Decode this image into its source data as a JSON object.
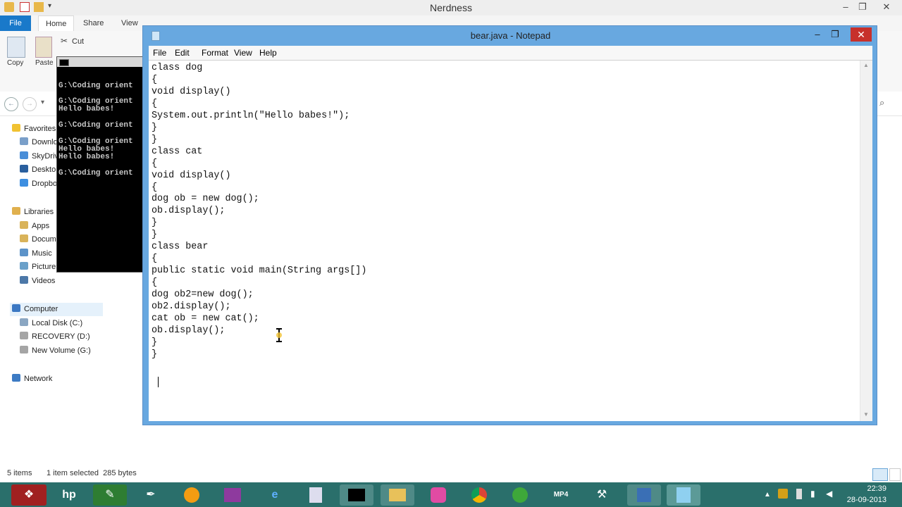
{
  "explorer": {
    "window_title": "Nerdness",
    "tabs": [
      "File",
      "Home",
      "Share",
      "View"
    ],
    "ribbon": {
      "copy": "Copy",
      "paste": "Paste",
      "cut": "Cut"
    },
    "nav": {
      "favorites": "Favorites",
      "fav_items": [
        "Downloads",
        "SkyDrive",
        "Desktop",
        "Dropbox"
      ],
      "libraries": "Libraries",
      "lib_items": [
        "Apps",
        "Documents",
        "Music",
        "Pictures",
        "Videos"
      ],
      "computer": "Computer",
      "drives": [
        "Local Disk (C:)",
        "RECOVERY (D:)",
        "New Volume (G:)"
      ],
      "network": "Network"
    },
    "status": {
      "items": "5 items",
      "selection": "1 item selected  285 bytes"
    }
  },
  "console": {
    "lines": [
      "G:\\Coding orient",
      "",
      "G:\\Coding orient",
      "Hello babes!",
      "",
      "G:\\Coding orient",
      "",
      "G:\\Coding orient",
      "Hello babes!",
      "Hello babes!",
      "",
      "G:\\Coding orient"
    ]
  },
  "notepad": {
    "title": "bear.java - Notepad",
    "menu": [
      "File",
      "Edit",
      "Format",
      "View",
      "Help"
    ],
    "code": "class dog\n{\nvoid display()\n{\nSystem.out.println(\"Hello babes!\");\n}\n}\nclass cat\n{\nvoid display()\n{\ndog ob = new dog();\nob.display();\n}\n}\nclass bear\n{\npublic static void main(String args[])\n{\ndog ob2=new dog();\nob2.display();\ncat ob = new cat();\nob.display();\n}\n}"
  },
  "taskbar": {
    "apps": [
      "start-icon",
      "hp-icon",
      "excel-icon",
      "pen-icon",
      "media-icon",
      "onenote-icon",
      "ie-icon",
      "folder-icon",
      "cmd-icon",
      "explorer-icon",
      "app-icon",
      "chrome-icon",
      "utorrent-icon",
      "mp4-icon",
      "tool-icon",
      "save-icon",
      "notepad-icon"
    ],
    "time": "22:39",
    "date": "28-09-2013"
  },
  "colors": {
    "notepad_frame": "#68a8e0",
    "taskbar": "#2a6f6b",
    "close": "#c7302b",
    "file_tab": "#1979ca"
  }
}
